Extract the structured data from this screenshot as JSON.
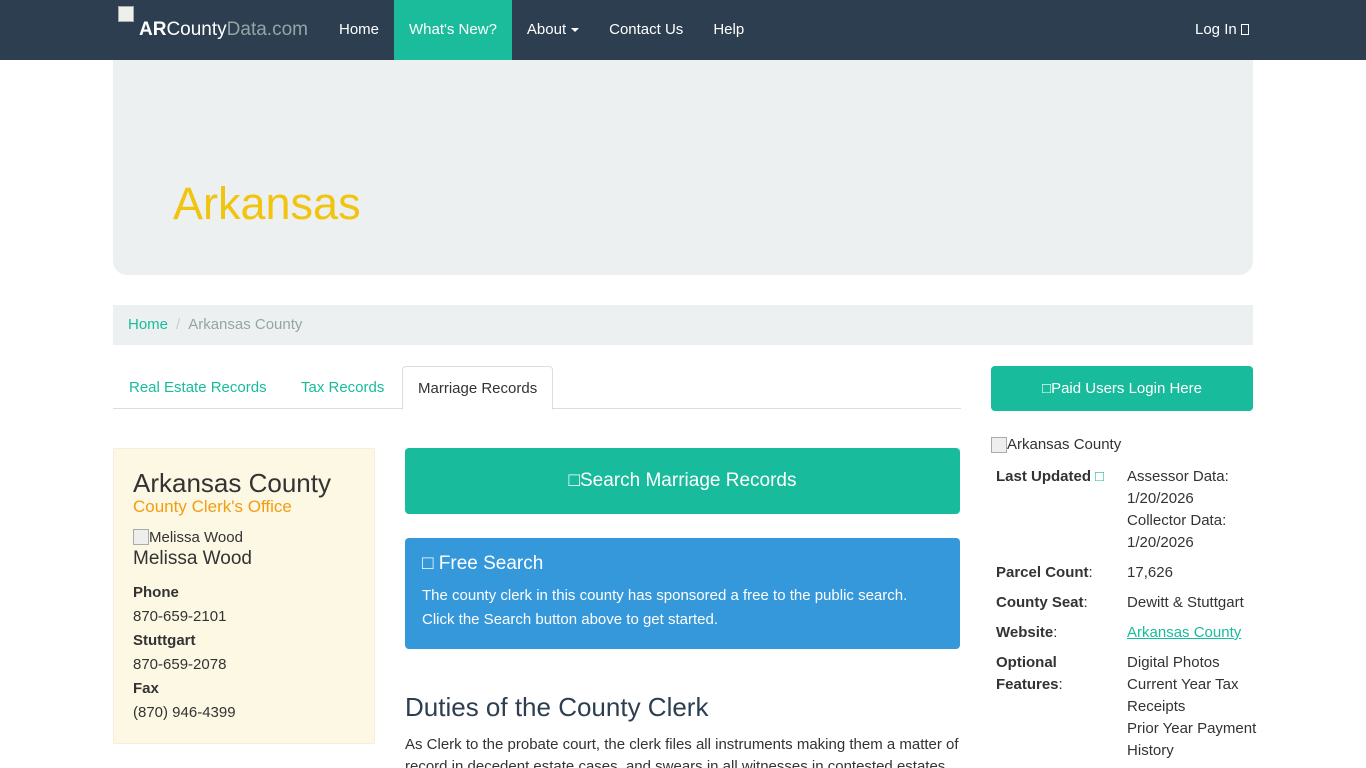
{
  "navbar": {
    "brand_part1": "AR",
    "brand_part2": "County",
    "brand_part3": "Data",
    "brand_part4": ".com",
    "items": [
      {
        "label": "Home"
      },
      {
        "label": "What's New?"
      },
      {
        "label": "About"
      },
      {
        "label": "Contact Us"
      },
      {
        "label": "Help"
      }
    ],
    "login_label": "Log In"
  },
  "jumbotron": {
    "title": "Arkansas"
  },
  "breadcrumb": {
    "home": "Home",
    "current": "Arkansas County"
  },
  "tabs": [
    {
      "label": "Real Estate Records"
    },
    {
      "label": "Tax Records"
    },
    {
      "label": "Marriage Records"
    }
  ],
  "clerk": {
    "county": "Arkansas County",
    "office": "County Clerk's Office",
    "image_alt": "Melissa Wood",
    "name": "Melissa Wood",
    "phone_label": "Phone",
    "phone": "870-659-2101",
    "stuttgart_label": "Stuttgart",
    "stuttgart_phone": "870-659-2078",
    "fax_label": "Fax",
    "fax": "(870) 946-4399"
  },
  "search_button": "Search Marriage Records",
  "free_search": {
    "title": "Free Search",
    "line1": "The county clerk in this county has sponsored a free to the public search.",
    "line2": "Click the Search button above to get started."
  },
  "duties": {
    "heading": "Duties of the County Clerk",
    "text": "As Clerk to the probate court, the clerk files all instruments making them a matter of record in decedent estate cases, and swears in all witnesses in contested estates."
  },
  "paid_login": "Paid Users Login Here",
  "county_image_alt": "Arkansas County",
  "info": {
    "last_updated_label": "Last Updated",
    "assessor_label": "Assessor Data:",
    "assessor_date": "1/20/2026",
    "collector_label": "Collector Data:",
    "collector_date": "1/20/2026",
    "parcel_label": "Parcel Count",
    "parcel_count": "17,626",
    "seat_label": "County Seat",
    "seat": "Dewitt & Stuttgart",
    "website_label": "Website",
    "website": "Arkansas County",
    "optional_label_1": "Optional",
    "optional_label_2": "Features",
    "features": [
      "Digital Photos",
      "Current Year Tax Receipts",
      "Prior Year Payment History"
    ]
  },
  "colors": {
    "nav_bg": "#2c3e50",
    "accent": "#18bc9c",
    "title_yellow": "#f1c40f",
    "alert_blue": "#3498db",
    "office_orange": "#f39c12"
  }
}
